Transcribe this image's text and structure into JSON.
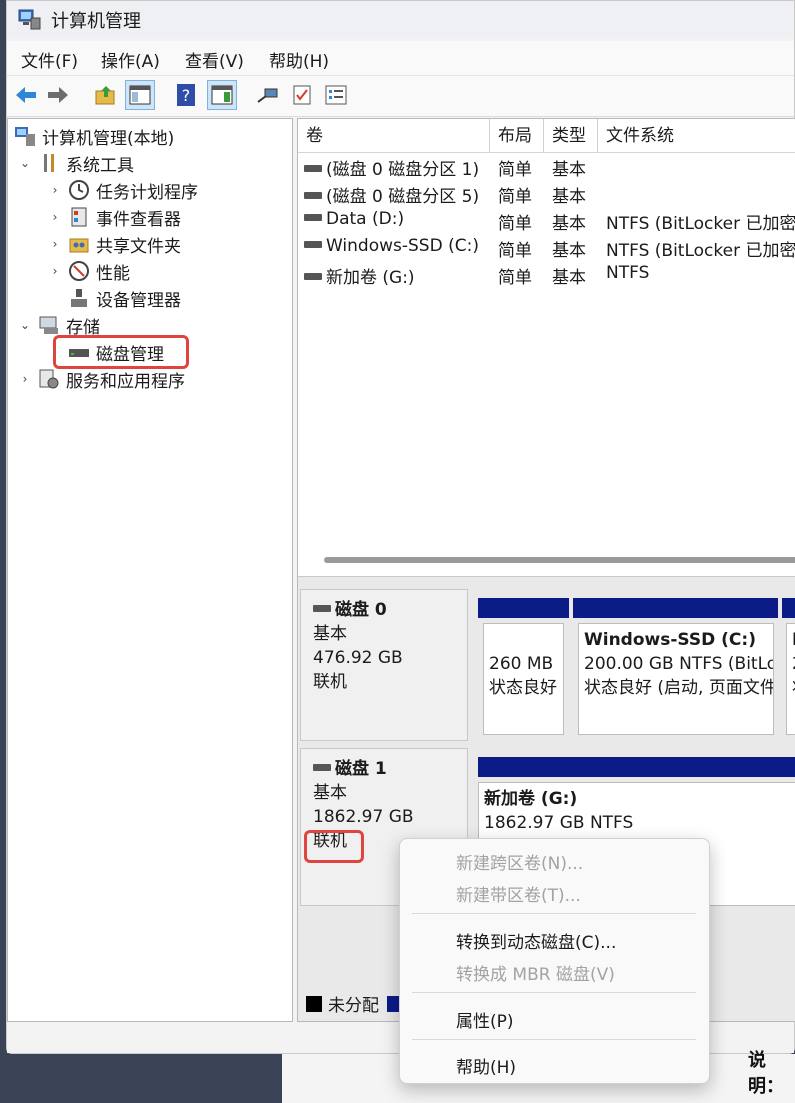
{
  "window": {
    "title": "计算机管理"
  },
  "menu": [
    "文件(F)",
    "操作(A)",
    "查看(V)",
    "帮助(H)"
  ],
  "tree": {
    "root": "计算机管理(本地)",
    "system_tools": "系统工具",
    "task_scheduler": "任务计划程序",
    "event_viewer": "事件查看器",
    "shared_folders": "共享文件夹",
    "performance": "性能",
    "device_manager": "设备管理器",
    "storage": "存储",
    "disk_management": "磁盘管理",
    "services_apps": "服务和应用程序"
  },
  "volume_list": {
    "headers": [
      "卷",
      "布局",
      "类型",
      "文件系统"
    ],
    "rows": [
      {
        "name": "(磁盘 0 磁盘分区 1)",
        "layout": "简单",
        "type": "基本",
        "fs": ""
      },
      {
        "name": "(磁盘 0 磁盘分区 5)",
        "layout": "简单",
        "type": "基本",
        "fs": ""
      },
      {
        "name": "Data (D:)",
        "layout": "简单",
        "type": "基本",
        "fs": "NTFS (BitLocker 已加密"
      },
      {
        "name": "Windows-SSD (C:)",
        "layout": "简单",
        "type": "基本",
        "fs": "NTFS (BitLocker 已加密"
      },
      {
        "name": "新加卷 (G:)",
        "layout": "简单",
        "type": "基本",
        "fs": "NTFS"
      }
    ]
  },
  "disks": [
    {
      "name": "磁盘 0",
      "kind": "基本",
      "size": "476.92 GB",
      "state": "联机",
      "partitions": [
        {
          "title": "",
          "line1": "260 MB",
          "line2": "状态良好"
        },
        {
          "title": "Windows-SSD  (C:)",
          "line1": "200.00 GB NTFS (BitLo",
          "line2": "状态良好 (启动, 页面文件"
        },
        {
          "title": "D",
          "line1": "2",
          "line2": "状"
        }
      ]
    },
    {
      "name": "磁盘 1",
      "kind": "基本",
      "size": "1862.97 GB",
      "state": "联机",
      "partitions": [
        {
          "title": "新加卷  (G:)",
          "line1": "1862.97 GB NTFS",
          "line2": ""
        }
      ]
    }
  ],
  "legend": {
    "unallocated": "未分配"
  },
  "context_menu": {
    "items": [
      {
        "label": "新建跨区卷(N)...",
        "enabled": false
      },
      {
        "label": "新建带区卷(T)...",
        "enabled": false
      },
      {
        "label": "转换到动态磁盘(C)...",
        "enabled": true
      },
      {
        "label": "转换成 MBR 磁盘(V)",
        "enabled": false
      },
      {
        "label": "属性(P)",
        "enabled": true
      },
      {
        "label": "帮助(H)",
        "enabled": true
      }
    ]
  },
  "background": {
    "partial_text": "说明："
  },
  "colors": {
    "partition_bar": "#0b1c87",
    "highlight": "#e0443f",
    "selection": "#cde5f7"
  }
}
